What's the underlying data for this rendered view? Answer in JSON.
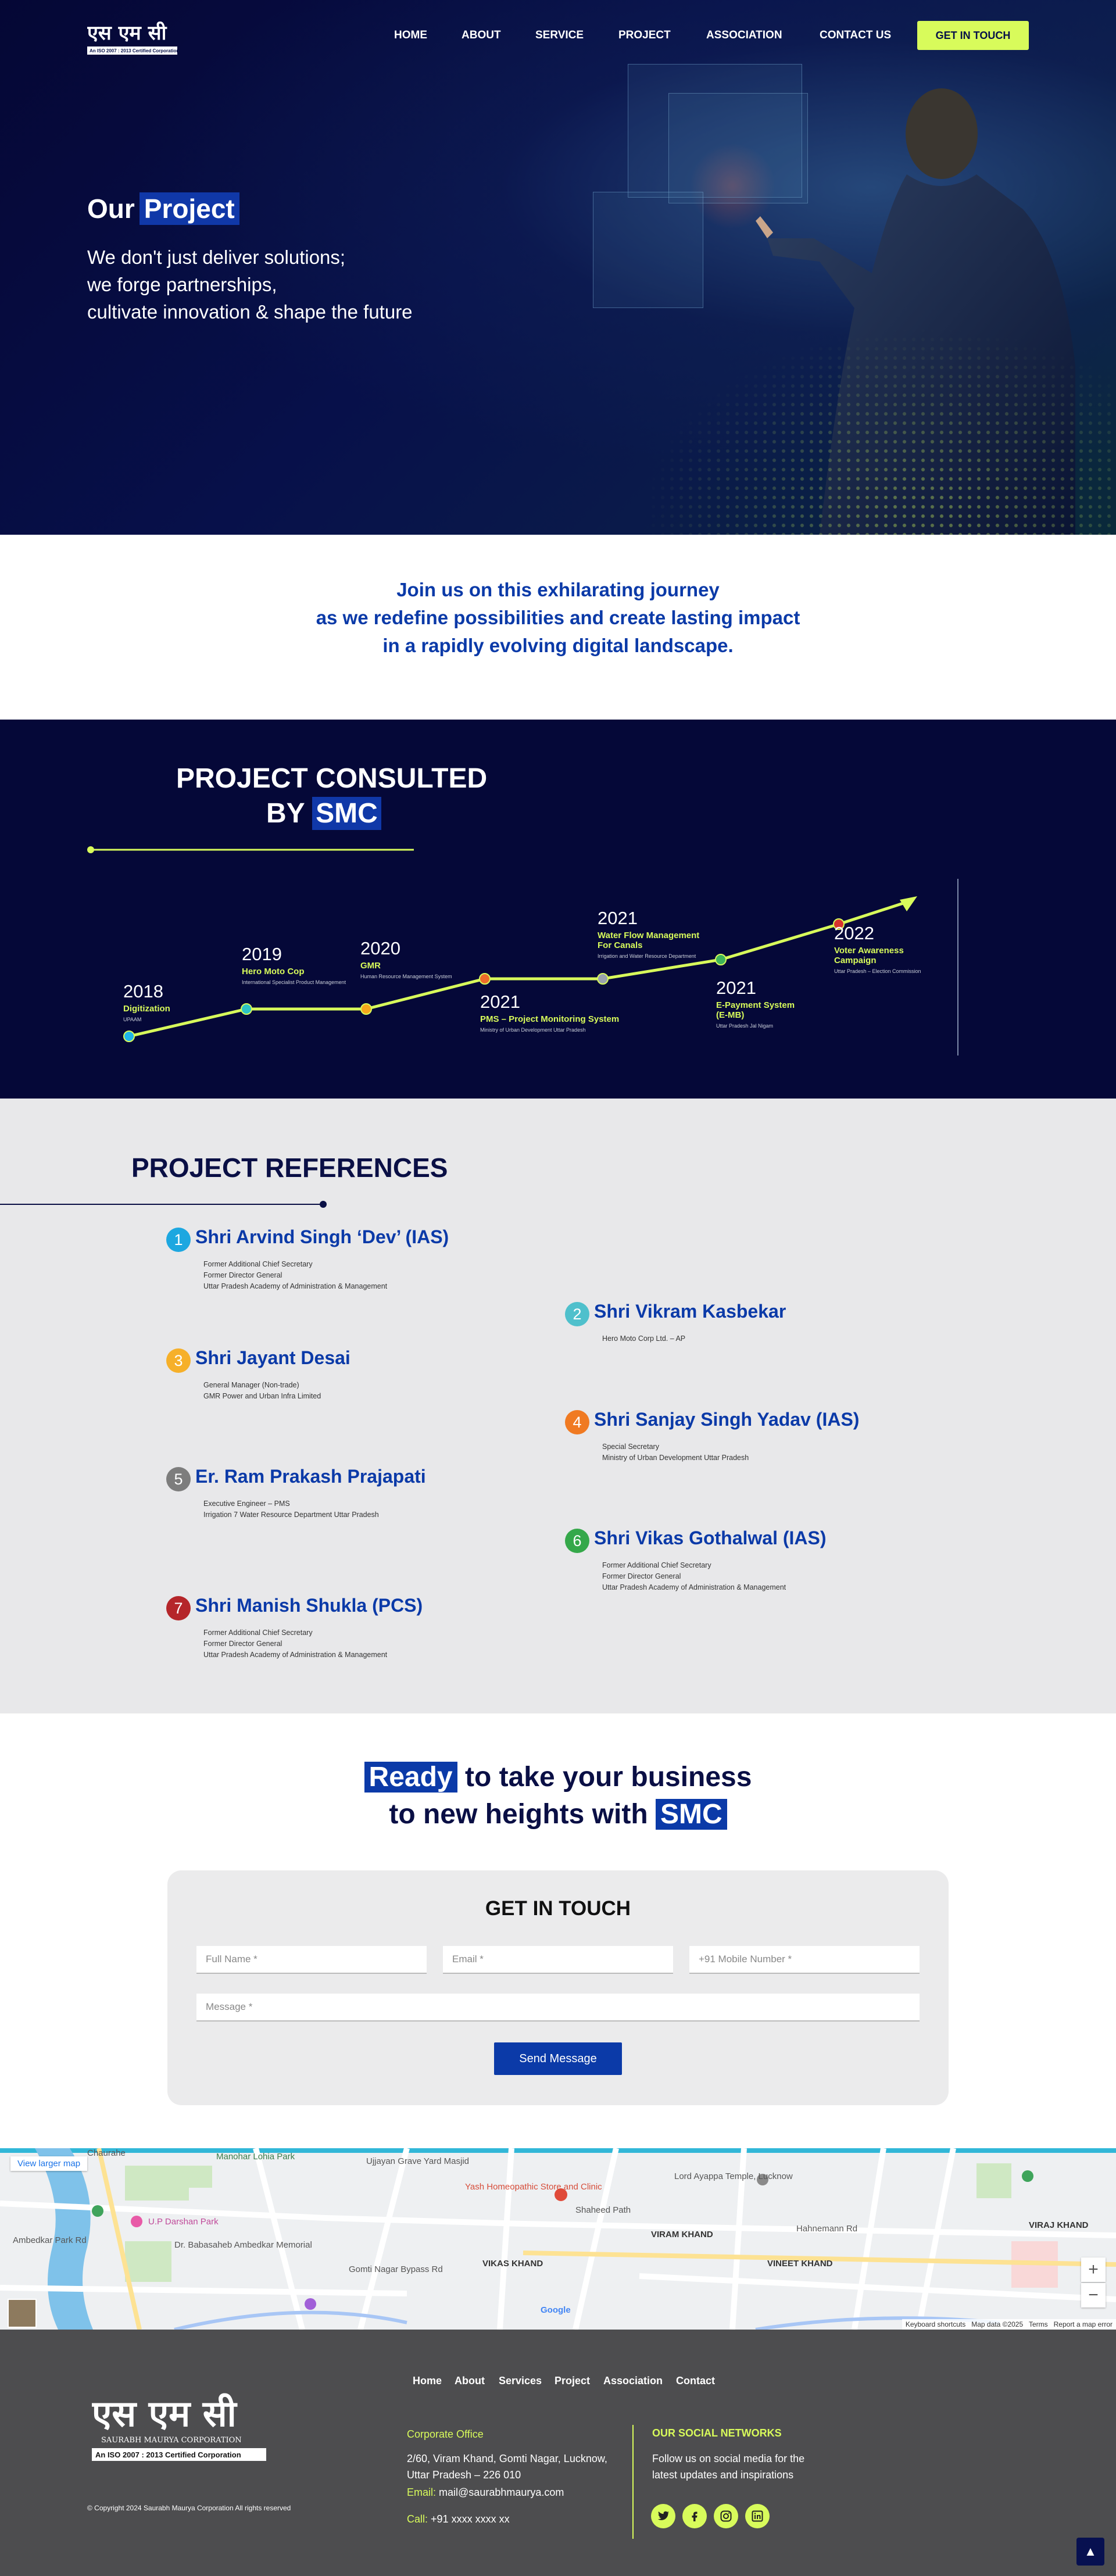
{
  "brand": {
    "logo_text": "एस एम सी",
    "logo_tagline": "An ISO 2007 : 2013 Certified Corporation",
    "footer_logo_subtitle": "SAURABH MAURYA CORPORATION",
    "footer_logo_tagline": "An ISO 2007 : 2013 Certified Corporation"
  },
  "nav": {
    "items": [
      "HOME",
      "ABOUT",
      "SERVICE",
      "PROJECT",
      "ASSOCIATION",
      "CONTACT US"
    ],
    "cta": "GET IN TOUCH"
  },
  "hero": {
    "title_plain": "Our",
    "title_highlight": "Project",
    "lines": [
      "We don't just deliver solutions;",
      "we forge partnerships,",
      "cultivate innovation & shape the future"
    ]
  },
  "journey": {
    "lines": [
      "Join us on this exhilarating journey",
      "as we redefine possibilities and create lasting impact",
      "in a rapidly evolving digital landscape."
    ]
  },
  "timeline": {
    "title_line1": "PROJECT CONSULTED",
    "title_line2_plain": "BY",
    "title_line2_highlight": "SMC",
    "events": [
      {
        "year": "2018",
        "title": "Digitization",
        "sub": "UPAAM"
      },
      {
        "year": "2019",
        "title": "Hero Moto Cop",
        "sub": "International Specialist Product Management"
      },
      {
        "year": "2020",
        "title": "GMR",
        "sub": "Human Resource Management System"
      },
      {
        "year": "2021",
        "title": "PMS – Project Monitoring System",
        "sub": "Ministry of Urban Development Uttar Pradesh"
      },
      {
        "year": "2021",
        "title": "Water Flow Management For Canals",
        "sub": "Irrigation and Water Resource Department"
      },
      {
        "year": "2021",
        "title": "E-Payment System (E-MB)",
        "sub": "Uttar Pradesh Jal Nigam"
      },
      {
        "year": "2022",
        "title": "Voter Awareness Campaign",
        "sub": "Uttar Pradesh – Election Commission"
      }
    ],
    "marker_colors": [
      "#1fb6ea",
      "#2ec4c4",
      "#f6a81c",
      "#ee6c2a",
      "#9aa3ad",
      "#3fb559",
      "#d8342e"
    ]
  },
  "references": {
    "title": "PROJECT REFERENCES",
    "items": [
      {
        "num": "1",
        "name": "Shri Arvind Singh ‘Dev’ (IAS)",
        "desc": [
          "Former Additional Chief Secretary",
          "Former Director General",
          "Uttar Pradesh Academy of Administration & Management"
        ],
        "color": "#1da7e0"
      },
      {
        "num": "2",
        "name": "Shri Vikram Kasbekar",
        "desc": [
          "Hero Moto Corp Ltd. – AP"
        ],
        "color": "#4fc0cc"
      },
      {
        "num": "3",
        "name": "Shri Jayant Desai",
        "desc": [
          "General Manager (Non-trade)",
          "GMR Power and Urban Infra Limited"
        ],
        "color": "#f6b02a"
      },
      {
        "num": "4",
        "name": "Shri Sanjay Singh Yadav (IAS)",
        "desc": [
          "Special Secretary",
          "Ministry of Urban Development Uttar Pradesh"
        ],
        "color": "#f07a22"
      },
      {
        "num": "5",
        "name": "Er. Ram Prakash Prajapati",
        "desc": [
          "Executive Engineer – PMS",
          "Irrigation 7 Water Resource Department Uttar Pradesh"
        ],
        "color": "#7d7d7d"
      },
      {
        "num": "6",
        "name": "Shri Vikas Gothalwal (IAS)",
        "desc": [
          "Former Additional Chief Secretary",
          "Former Director General",
          "Uttar Pradesh Academy of Administration & Management"
        ],
        "color": "#35a84a"
      },
      {
        "num": "7",
        "name": "Shri Manish Shukla (PCS)",
        "desc": [
          "Former Additional Chief Secretary",
          "Former Director General",
          "Uttar Pradesh Academy of Administration & Management"
        ],
        "color": "#b5262a"
      }
    ]
  },
  "cta": {
    "line1_highlight": "Ready",
    "line1_rest": "to take your business",
    "line2_plain": "to new heights with",
    "line2_highlight": "SMC"
  },
  "form": {
    "title": "GET IN TOUCH",
    "name_placeholder": "Full Name *",
    "email_placeholder": "Email *",
    "mobile_placeholder": "+91 Mobile Number *",
    "message_placeholder": "Message *",
    "submit": "Send Message"
  },
  "map": {
    "larger_map": "View larger map",
    "labels": [
      "Manohar Lohia Park",
      "Ujjayan Grave Yard Masjid",
      "Yash Homeopathic Store and Clinic",
      "Lord Ayappa Temple, Lucknow",
      "U.P Darshan Park",
      "Dr. Babasaheb Ambedkar Memorial",
      "VIKAS KHAND",
      "VIRAM KHAND",
      "VINEET KHAND",
      "VIRAJ KHAND",
      "Ambedkar Park Rd",
      "Gomti Nagar Bypass Rd",
      "Shaheed Path",
      "Hahnemann Rd",
      "Chaurahe"
    ],
    "attribution": [
      "Keyboard shortcuts",
      "Map data ©2025",
      "Terms",
      "Report a map error"
    ],
    "google": "Google"
  },
  "footer": {
    "nav": [
      "Home",
      "About",
      "Services",
      "Project",
      "Association",
      "Contact"
    ],
    "office_label": "Corporate Office",
    "address_lines": [
      "2/60, Viram Khand, Gomti Nagar, Lucknow,",
      "Uttar Pradesh – 226 010"
    ],
    "email_label": "Email:",
    "email": "mail@saurabhmaurya.com",
    "call_label": "Call:",
    "phone": "+91 xxxx xxxx xx",
    "social_title": "OUR SOCIAL NETWORKS",
    "social_text": [
      "Follow us on social media for the",
      "latest updates and inspirations"
    ],
    "social_icons": [
      "twitter-icon",
      "facebook-icon",
      "instagram-icon",
      "linkedin-icon"
    ],
    "copyright": "© Copyright 2024 Saurabh Maurya Corporation All rights reserved"
  },
  "colors": {
    "navy": "#050838",
    "accent": "#d8fb5b",
    "blue": "#0b3aa8",
    "footer": "#4d4d4f"
  }
}
